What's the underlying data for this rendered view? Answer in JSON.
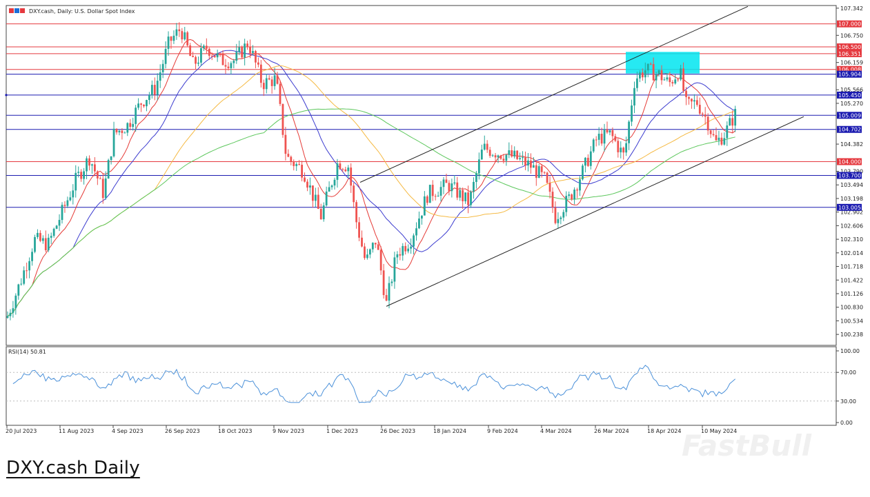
{
  "chart_data": {
    "type": "candlestick",
    "title": "DXY.cash, Daily:  U.S. Dollar Spot Index",
    "caption": "DXY.cash Daily",
    "watermark": "FastBull",
    "price_axis": {
      "min": 100.0,
      "max": 107.4,
      "tick_labels": [
        "107.342",
        "106.750",
        "106.159",
        "105.566",
        "105.270",
        "104.382",
        "103.790",
        "103.494",
        "103.198",
        "102.902",
        "102.606",
        "102.310",
        "102.014",
        "101.718",
        "101.422",
        "101.126",
        "100.830",
        "100.534",
        "100.238"
      ]
    },
    "date_axis": {
      "tick_labels": [
        "20 Jul 2023",
        "11 Aug 2023",
        "4 Sep 2023",
        "26 Sep 2023",
        "18 Oct 2023",
        "9 Nov 2023",
        "1 Dec 2023",
        "26 Dec 2023",
        "18 Jan 2024",
        "9 Feb 2024",
        "4 Mar 2024",
        "26 Mar 2024",
        "18 Apr 2024",
        "10 May 2024"
      ]
    },
    "horizontal_levels": [
      {
        "label": "107.000",
        "value": 107.0,
        "color": "#e5393f",
        "label_bg": "#e5393f"
      },
      {
        "label": "106.500",
        "value": 106.5,
        "color": "#e5393f",
        "label_bg": "#e5393f"
      },
      {
        "label": "106.351",
        "value": 106.351,
        "color": "#e5393f",
        "label_bg": "#e5393f"
      },
      {
        "label": "106.008",
        "value": 106.008,
        "color": "#e5393f",
        "label_bg": "#e5393f"
      },
      {
        "label": "105.904",
        "value": 105.904,
        "color": "#1a1ab0",
        "label_bg": "#1a1ab0"
      },
      {
        "label": "105.450",
        "value": 105.45,
        "color": "#1a1ab0",
        "label_bg": "#1a1ab0"
      },
      {
        "label": "105.009",
        "value": 105.009,
        "color": "#1a1ab0",
        "label_bg": "#1a1ab0"
      },
      {
        "label": "104.702",
        "value": 104.702,
        "color": "#1a1ab0",
        "label_bg": "#1a1ab0"
      },
      {
        "label": "104.000",
        "value": 104.0,
        "color": "#e5393f",
        "label_bg": "#e5393f"
      },
      {
        "label": "103.700",
        "value": 103.7,
        "color": "#1a1ab0",
        "label_bg": "#1a1ab0"
      },
      {
        "label": "103.005",
        "value": 103.005,
        "color": "#1a1ab0",
        "label_bg": "#1a1ab0"
      }
    ],
    "rsi": {
      "label": "RSI(14) 50.81",
      "tick_labels": [
        "100.00",
        "70.00",
        "30.00",
        "0.00"
      ],
      "levels": [
        70,
        30
      ],
      "color": "#4a90d9"
    },
    "colors": {
      "bull": "#26a69a",
      "bear": "#ef5350",
      "ma_fast": "#e53935",
      "ma_mid": "#3b3bcf",
      "ma_slow": "#f5b942",
      "ma_long": "#5cc75c",
      "zone": "#00e5f0"
    }
  }
}
